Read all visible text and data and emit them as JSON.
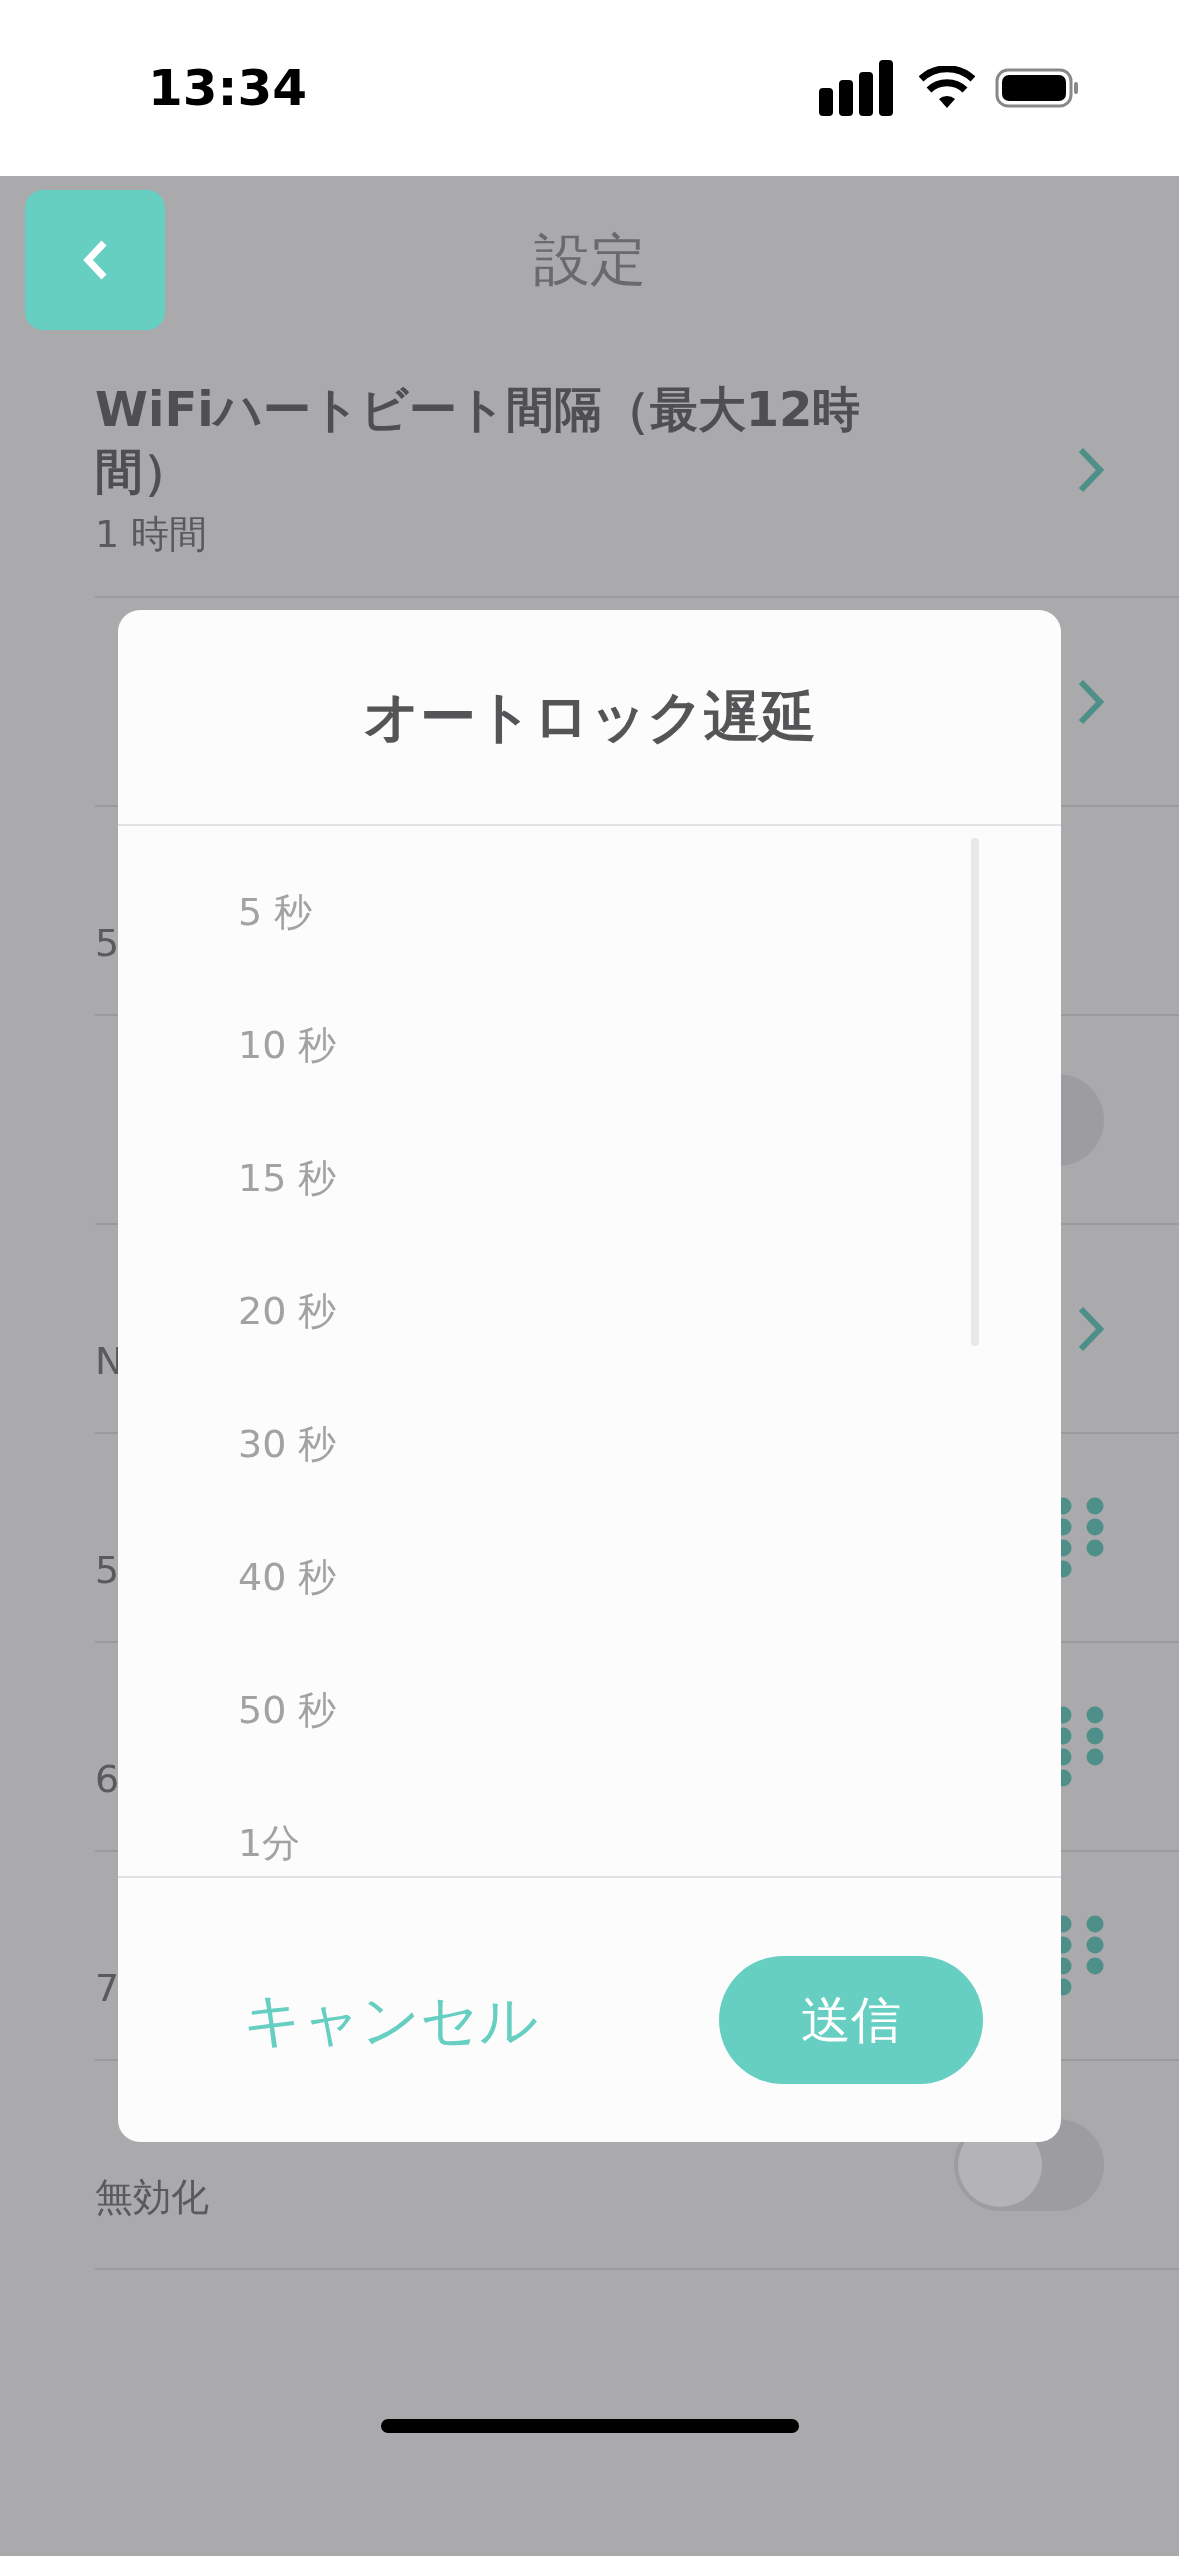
{
  "status_bar": {
    "time": "13:34"
  },
  "header": {
    "title": "設定"
  },
  "rows": [
    {
      "title": "WiFiハートビート間隔（最大12時間）",
      "value": "1 時間",
      "kind": "chevron"
    },
    {
      "kind": "chevron"
    },
    {
      "value": "5",
      "kind": "hidden"
    },
    {
      "kind": "toggle",
      "on": false
    },
    {
      "value": "N",
      "kind": "chevron"
    },
    {
      "value": "5",
      "kind": "keypad"
    },
    {
      "value": "6",
      "kind": "keypad"
    },
    {
      "value": "7",
      "kind": "keypad"
    },
    {
      "value": "無効化",
      "kind": "toggle",
      "on": false
    }
  ],
  "dialog": {
    "title": "オートロック遅延",
    "options": [
      "5 秒",
      "10 秒",
      "15 秒",
      "20 秒",
      "30 秒",
      "40 秒",
      "50 秒",
      "1分"
    ],
    "cancel": "キャンセル",
    "submit": "送信"
  }
}
